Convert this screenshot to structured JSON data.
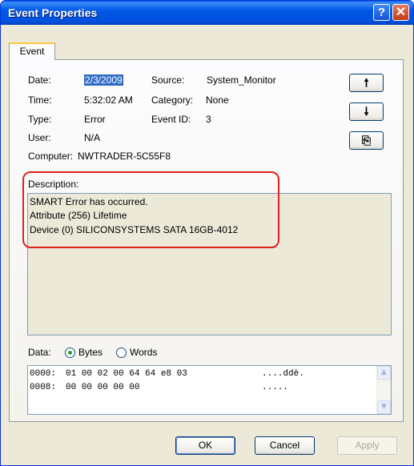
{
  "window": {
    "title": "Event Properties",
    "help_label": "?",
    "close_label": "✕"
  },
  "tabs": [
    {
      "label": "Event"
    }
  ],
  "fields": {
    "date": {
      "label": "Date:",
      "value": "2/3/2009"
    },
    "time": {
      "label": "Time:",
      "value": "5:32:02 AM"
    },
    "type": {
      "label": "Type:",
      "value": "Error"
    },
    "user": {
      "label": "User:",
      "value": "N/A"
    },
    "computer": {
      "label": "Computer:",
      "value": "NWTRADER-5C55F8"
    },
    "source": {
      "label": "Source:",
      "value": "System_Monitor"
    },
    "category": {
      "label": "Category:",
      "value": "None"
    },
    "event_id": {
      "label": "Event ID:",
      "value": "3"
    }
  },
  "nav_buttons": {
    "up": "🠕",
    "down": "🠗",
    "copy": "⎘"
  },
  "description": {
    "label": "Description:",
    "lines": [
      "SMART Error has occurred.",
      "Attribute (256) Lifetime",
      "Device (0) SILICONSYSTEMS SATA 16GB-4012"
    ]
  },
  "data": {
    "label": "Data:",
    "format_options": [
      "Bytes",
      "Words"
    ],
    "selected_format": "Bytes",
    "rows": [
      {
        "offset": "0000:",
        "hex": "01 00 02 00 64 64 e8 03",
        "ascii": "....ddè."
      },
      {
        "offset": "0008:",
        "hex": "00 00 00 00 00",
        "ascii": "....."
      }
    ]
  },
  "buttons": {
    "ok": "OK",
    "cancel": "Cancel",
    "apply": "Apply"
  },
  "colors": {
    "titlebar": "#0058e6",
    "selection": "#316ac5",
    "highlight_ring": "#e0201e"
  }
}
